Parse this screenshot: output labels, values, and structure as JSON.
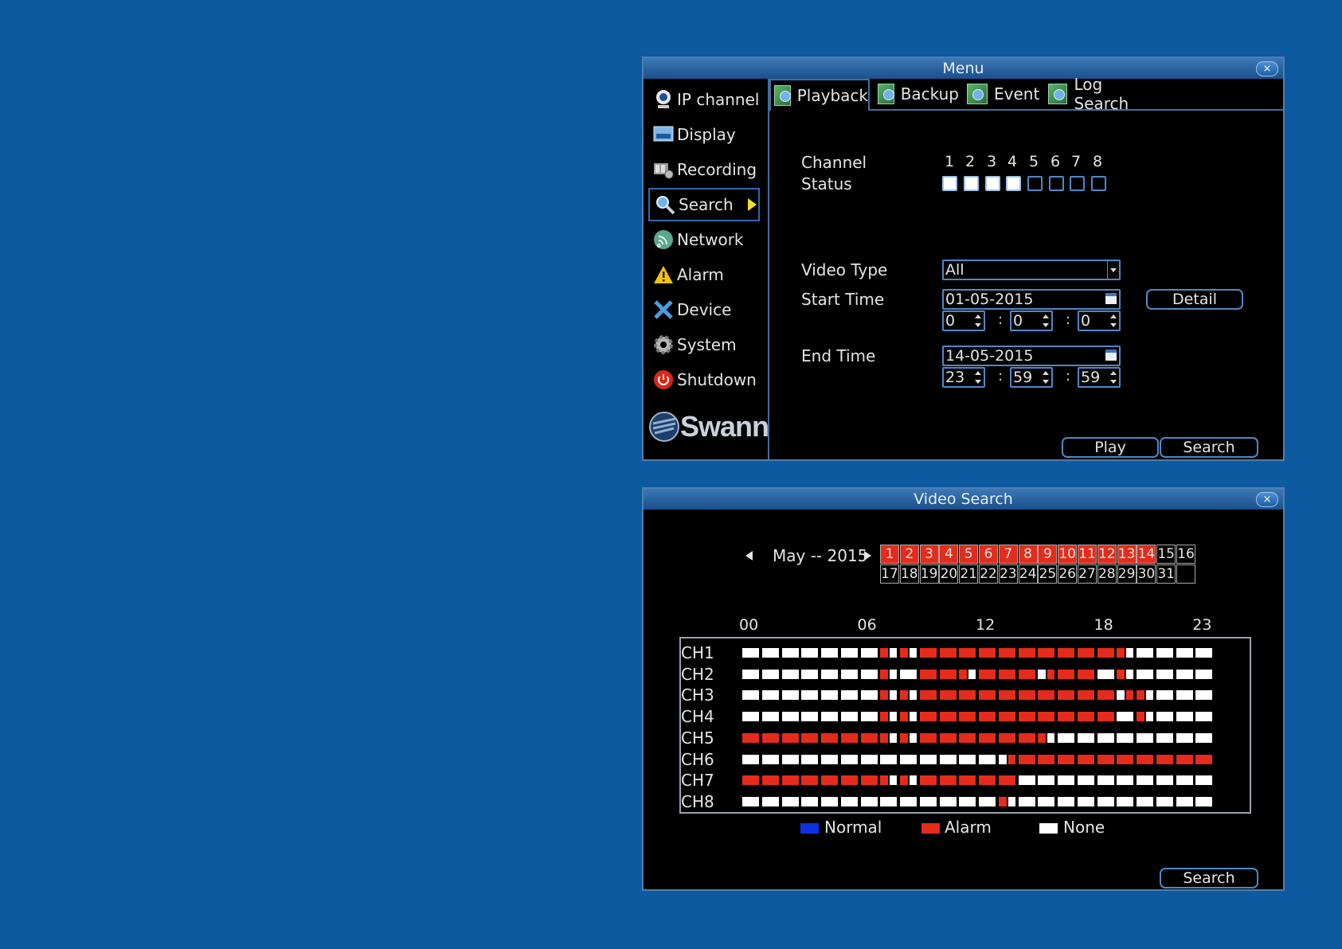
{
  "menu_window": {
    "title": "Menu",
    "close_label": "×",
    "sidebar": [
      {
        "label": "IP channel",
        "icon": "ip-camera-icon"
      },
      {
        "label": "Display",
        "icon": "display-icon"
      },
      {
        "label": "Recording",
        "icon": "recording-icon"
      },
      {
        "label": "Search",
        "icon": "search-icon",
        "active": true
      },
      {
        "label": "Network",
        "icon": "network-icon"
      },
      {
        "label": "Alarm",
        "icon": "alarm-icon"
      },
      {
        "label": "Device",
        "icon": "device-icon"
      },
      {
        "label": "System",
        "icon": "system-icon"
      },
      {
        "label": "Shutdown",
        "icon": "shutdown-icon"
      }
    ],
    "logo": "Swann",
    "tabs": [
      {
        "label": "Playback",
        "active": true
      },
      {
        "label": "Backup"
      },
      {
        "label": "Event"
      },
      {
        "label": "Log Search"
      }
    ],
    "channel_label": "Channel",
    "status_label": "Status",
    "channels": [
      "1",
      "2",
      "3",
      "4",
      "5",
      "6",
      "7",
      "8"
    ],
    "channel_checked": [
      true,
      true,
      true,
      true,
      false,
      false,
      false,
      false
    ],
    "video_type_label": "Video Type",
    "video_type_value": "All",
    "start_time_label": "Start Time",
    "start_date": "01-05-2015",
    "start_h": "0",
    "start_m": "0",
    "start_s": "0",
    "detail_label": "Detail",
    "end_time_label": "End Time",
    "end_date": "14-05-2015",
    "end_h": "23",
    "end_m": "59",
    "end_s": "59",
    "time_sep": ":",
    "play_label": "Play",
    "search_label": "Search"
  },
  "video_search_window": {
    "title": "Video Search",
    "close_label": "×",
    "month_label": "May -- 2015",
    "days_row1": [
      "1",
      "2",
      "3",
      "4",
      "5",
      "6",
      "7",
      "8",
      "9",
      "10",
      "11",
      "12",
      "13",
      "14",
      "15",
      "16"
    ],
    "days_row2": [
      "17",
      "18",
      "19",
      "20",
      "21",
      "22",
      "23",
      "24",
      "25",
      "26",
      "27",
      "28",
      "29",
      "30",
      "31",
      ""
    ],
    "alarm_days": [
      "1",
      "2",
      "3",
      "4",
      "5",
      "6",
      "7",
      "8",
      "9",
      "10",
      "11",
      "12",
      "13",
      "14"
    ],
    "hour_labels": [
      "00",
      "06",
      "12",
      "18",
      "23"
    ],
    "channels": [
      {
        "name": "CH1",
        "slots": "WWWWWWWHHRRRRRRRRRRHWWWW"
      },
      {
        "name": "CH2",
        "slots": "WWWWWWWHWRRrRRRwRRWHWWWW"
      },
      {
        "name": "CH3",
        "slots": "WWWWWWWHHRRRRRRRRRRhHWWWW"
      },
      {
        "name": "CH4",
        "slots": "WWWWWWWHHRRRRRRRRRRWHWWW"
      },
      {
        "name": "CH5",
        "slots": "RRRRRRRHHRRRRRRrWWWWWWWW"
      },
      {
        "name": "CH6",
        "slots": "WWWWWWWWWWWWWwRRRRRRRRRR"
      },
      {
        "name": "CH7",
        "slots": "RRRRRRRHHRRRRRWWWWWWWWWW"
      },
      {
        "name": "CH8",
        "slots": "WWWWWWWWWWWWWHWWWWWWWWWW"
      }
    ],
    "legend": [
      {
        "label": "Normal",
        "color": "#1030e0"
      },
      {
        "label": "Alarm",
        "color": "#e52b1b"
      },
      {
        "label": "None",
        "color": "#ffffff"
      }
    ],
    "search_label": "Search"
  },
  "colors": {
    "background": "#0d5aa0",
    "alarm": "#e52b1b",
    "none": "#ffffff",
    "accent_border": "#4f88c6"
  }
}
